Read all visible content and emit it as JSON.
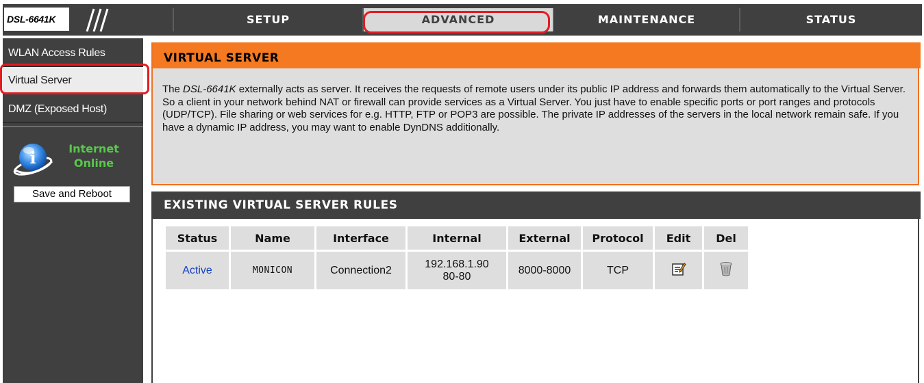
{
  "header": {
    "model": "DSL-6641K",
    "tabs": [
      {
        "label": "SETUP"
      },
      {
        "label": "ADVANCED"
      },
      {
        "label": "MAINTENANCE"
      },
      {
        "label": "STATUS"
      }
    ],
    "active_tab": "ADVANCED"
  },
  "sidebar": {
    "items": [
      {
        "label": "WLAN Access Rules"
      },
      {
        "label": "Virtual Server"
      },
      {
        "label": "DMZ (Exposed Host)"
      }
    ],
    "selected_item": "Virtual Server",
    "internet_status": {
      "line1": "Internet",
      "line2": "Online"
    },
    "save_button_label": "Save and Reboot"
  },
  "virtual_server": {
    "title": "VIRTUAL SERVER",
    "description_prefix": "The ",
    "description_model": "DSL-6641K",
    "description_rest": " externally acts as server. It receives the requests of remote users under its public IP address and forwards them automatically to the Virtual Server. So a client in your network behind NAT or firewall can provide services as a Virtual Server. You just have to enable specific ports or port ranges and protocols (UDP/TCP). File sharing or web services for e.g. HTTP, FTP or POP3 are possible. The private IP addresses of the servers in the local network remain safe. If you have a dynamic IP address, you may want to enable DynDNS additionally."
  },
  "rules": {
    "title": "EXISTING VIRTUAL SERVER RULES",
    "columns": [
      "Status",
      "Name",
      "Interface",
      "Internal",
      "External",
      "Protocol",
      "Edit",
      "Del"
    ],
    "rows": [
      {
        "status": "Active",
        "name": "MONICON",
        "interface": "Connection2",
        "internal_ip": "192.168.1.90",
        "internal_ports": "80-80",
        "external": "8000-8000",
        "protocol": "TCP",
        "edit_icon": "edit-icon",
        "del_icon": "trash-icon"
      }
    ]
  },
  "colors": {
    "header_bg": "#404040",
    "accent_orange": "#f47920",
    "panel_gray": "#dedede",
    "highlight_red": "#e21c21",
    "online_green": "#58c84a",
    "link_blue": "#1640c8"
  }
}
